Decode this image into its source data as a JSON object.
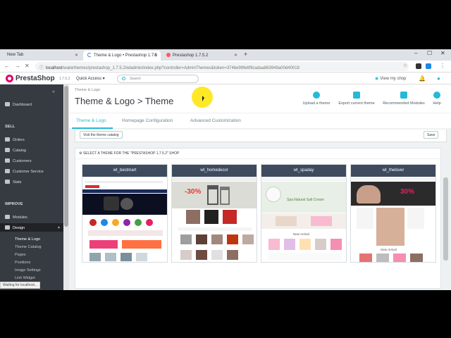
{
  "browser": {
    "tabs": [
      {
        "title": "New Tab"
      },
      {
        "title": "Theme & Logo • Prestashop 1.7.5"
      },
      {
        "title": "Prestashop 1.7.5.2"
      }
    ],
    "new_tab_icon": "plus-icon",
    "url_host": "localhost",
    "url_rest": "/waterthemes/prestashop_1.7.5.2/wtadmin/index.php?controller=AdminThemes&token=374be99fe6f9cadaa863949a00d40018",
    "status": "Waiting for localhost..."
  },
  "header": {
    "logo": "PrestaShop",
    "version": "1.7.5.2",
    "quick_access": "Quick Access ▾",
    "search_placeholder": "Search",
    "view_shop": "View my shop"
  },
  "sidebar": {
    "collapse_icon": "double-chevron-left-icon",
    "dashboard": "Dashboard",
    "sell_title": "SELL",
    "sell_items": [
      "Orders",
      "Catalog",
      "Customers",
      "Customer Service",
      "Stats"
    ],
    "improve_title": "IMPROVE",
    "modules": "Modules",
    "design": "Design",
    "design_sub": [
      "Theme & Logo",
      "Theme Catalog",
      "Pages",
      "Positions",
      "Image Settings",
      "Link Widget"
    ]
  },
  "page": {
    "breadcrumb": "Theme & Logo",
    "title": "Theme & Logo > Theme",
    "toolbar": {
      "upload": "Upload a theme",
      "export": "Export current theme",
      "recommended": "Recommended Modules",
      "help": "Help"
    },
    "tabs": [
      "Theme & Logo",
      "Homepage Configuration",
      "Advanced Customization"
    ],
    "visit_catalog": "Visit the theme catalog",
    "save": "Save",
    "select_heading": "SELECT A THEME FOR THE \"PRESTASHOP 1.7.5.2\" SHOP",
    "themes": [
      {
        "name": "wt_bestmart"
      },
      {
        "name": "wt_homedecor"
      },
      {
        "name": "wt_spaday"
      },
      {
        "name": "wt_thelover"
      }
    ],
    "preview_texts": {
      "homedecor_sale": "-30%",
      "spaday_banner": "Spa Natural Salt Cream",
      "spaday_section": "New Arrival",
      "thelover_sale": "30%",
      "thelover_section": "New Arrival"
    }
  },
  "colors": {
    "accent": "#25b9d7",
    "sidebar": "#363a41",
    "theme_header": "#3e4a5e",
    "logo": "#df0067"
  }
}
